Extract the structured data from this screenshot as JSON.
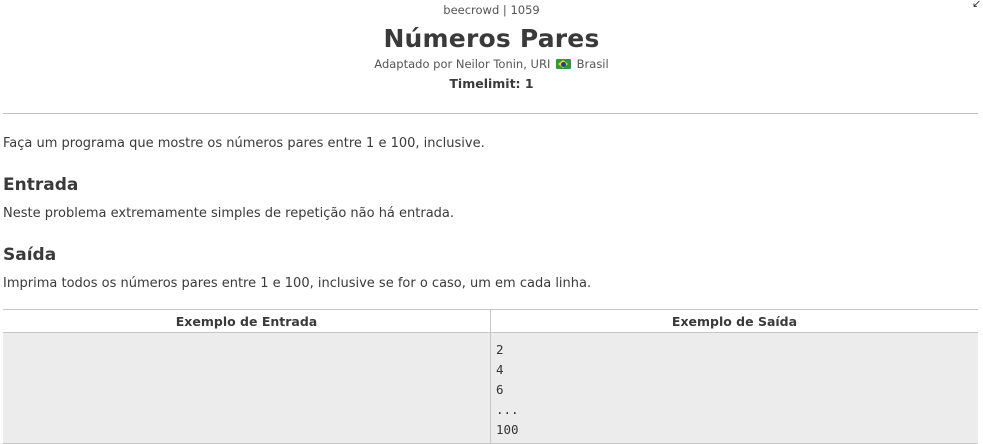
{
  "header": {
    "source": "beecrowd | 1059",
    "title": "Números Pares",
    "author_prefix": "Adaptado por Neilor Tonin, URI",
    "flag_icon": "brazil-flag-icon",
    "country": "Brasil",
    "timelimit": "Timelimit: 1"
  },
  "description": "Faça um programa que mostre os números pares entre 1 e 100, inclusive.",
  "input_section": {
    "heading": "Entrada",
    "text": "Neste problema extremamente simples de repetição não há entrada."
  },
  "output_section": {
    "heading": "Saída",
    "text": "Imprima todos os números pares entre 1 e 100, inclusive se for o caso, um em cada linha."
  },
  "samples": {
    "input_header": "Exemplo de Entrada",
    "output_header": "Exemplo de Saída",
    "input_lines": [],
    "output_lines": [
      "2",
      "4",
      "6",
      "...",
      "100"
    ]
  },
  "colors": {
    "text": "#3a3a3a",
    "sample_background": "#ececec",
    "divider": "#bdbdbd",
    "flag_green": "#2e9b3b",
    "flag_yellow": "#f4d21f",
    "flag_blue": "#23408e"
  }
}
